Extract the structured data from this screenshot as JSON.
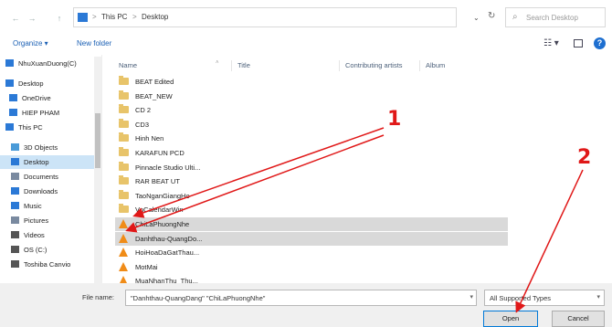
{
  "address": {
    "back": "←",
    "forward": "→",
    "up": "↑",
    "crumbs": [
      "This PC",
      "Desktop"
    ],
    "separator": ">",
    "dropdown": "⌄",
    "refresh": "↻",
    "search_placeholder": "Search Desktop",
    "search_icon": "magnifier-icon"
  },
  "toolbar": {
    "organize": "Organize ▾",
    "new_folder": "New folder",
    "view_icon": "☷ ▾",
    "help": "?"
  },
  "nav": {
    "items": [
      {
        "label": "NhuXuanDuong(C)",
        "icon": "user-icon",
        "color": "#2b79d6"
      },
      {
        "label": "Desktop",
        "icon": "desktop-icon",
        "color": "#2b79d6"
      },
      {
        "label": "OneDrive",
        "icon": "cloud-icon",
        "color": "#2b79d6"
      },
      {
        "label": "HIEP PHAM",
        "icon": "user-icon",
        "color": "#2b79d6"
      },
      {
        "label": "This PC",
        "icon": "computer-icon",
        "color": "#2b79d6"
      },
      {
        "label": "3D Objects",
        "icon": "cube-icon",
        "color": "#4a9bd8"
      },
      {
        "label": "Desktop",
        "icon": "desktop-icon",
        "color": "#2b79d6"
      },
      {
        "label": "Documents",
        "icon": "document-icon",
        "color": "#7a8aa0"
      },
      {
        "label": "Downloads",
        "icon": "download-icon",
        "color": "#2b79d6"
      },
      {
        "label": "Music",
        "icon": "music-icon",
        "color": "#2b79d6"
      },
      {
        "label": "Pictures",
        "icon": "picture-icon",
        "color": "#7a8aa0"
      },
      {
        "label": "Videos",
        "icon": "video-icon",
        "color": "#555"
      },
      {
        "label": "OS (C:)",
        "icon": "drive-icon",
        "color": "#555"
      },
      {
        "label": "Toshiba Canvio",
        "icon": "drive-icon",
        "color": "#555"
      }
    ]
  },
  "columns": {
    "name": "Name",
    "title": "Title",
    "artist": "Contributing artists",
    "album": "Album"
  },
  "files": [
    {
      "name": "BEAT Edited",
      "type": "folder",
      "selected": false
    },
    {
      "name": "BEAT_NEW",
      "type": "folder",
      "selected": false
    },
    {
      "name": "CD 2",
      "type": "folder",
      "selected": false
    },
    {
      "name": "CD3",
      "type": "folder",
      "selected": false
    },
    {
      "name": "Hinh Nen",
      "type": "folder",
      "selected": false
    },
    {
      "name": "KARAFUN PCD",
      "type": "folder",
      "selected": false
    },
    {
      "name": "Pinnacle Studio Ulti...",
      "type": "folder",
      "selected": false
    },
    {
      "name": "RAR BEAT UT",
      "type": "folder",
      "selected": false
    },
    {
      "name": "TaoNganGiangHo",
      "type": "folder",
      "selected": false
    },
    {
      "name": "VnCalendarWin",
      "type": "folder",
      "selected": false
    },
    {
      "name": "ChiLaPhuongNhe",
      "type": "vlc",
      "selected": true
    },
    {
      "name": "Danhthau-QuangDo...",
      "type": "vlc",
      "selected": true
    },
    {
      "name": "HoiHoaDaGatThau...",
      "type": "vlc",
      "selected": false
    },
    {
      "name": "MotMai",
      "type": "vlc",
      "selected": false
    },
    {
      "name": "MuaNhanThu_Thu...",
      "type": "vlc",
      "selected": false
    }
  ],
  "bottom": {
    "file_name_label": "File name:",
    "file_name_value": "\"Danhthau-QuangDang\" \"ChiLaPhuongNhe\"",
    "file_type": "All Supported Types",
    "open": "Open",
    "cancel": "Cancel"
  },
  "annotations": {
    "label1": "1",
    "label2": "2",
    "color": "#e01818"
  },
  "colors": {
    "selection": "#cce4f7",
    "row_selected": "#d9d9d9",
    "folder": "#e8c46a",
    "vlc": "#f08c18",
    "accent": "#0078d7"
  }
}
